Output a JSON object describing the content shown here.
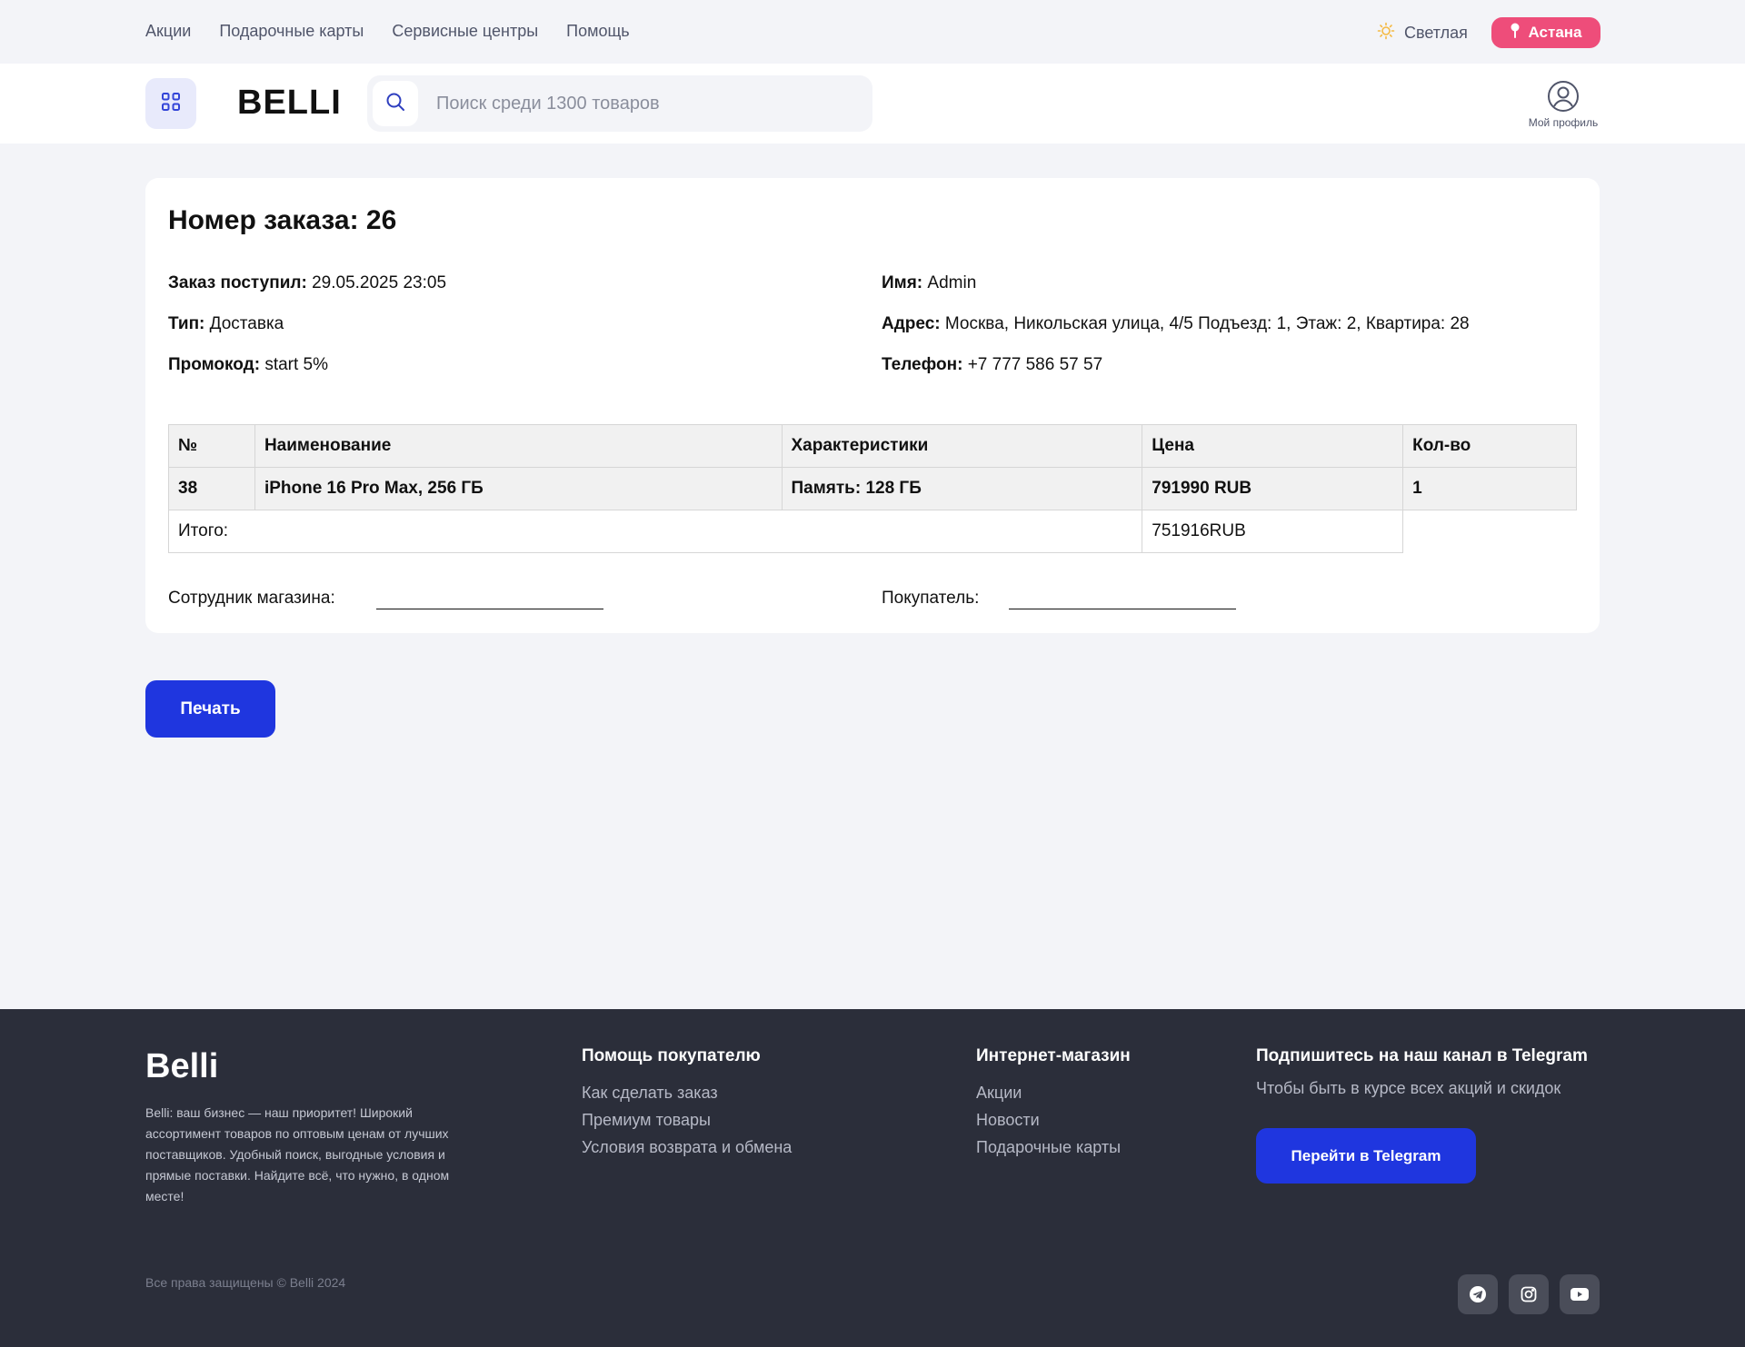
{
  "topnav": {
    "links": [
      "Акции",
      "Подарочные карты",
      "Сервисные центры",
      "Помощь"
    ],
    "theme_label": "Светлая",
    "city": "Астана"
  },
  "header": {
    "logo": "BELLI",
    "search_placeholder": "Поиск среди 1300 товаров",
    "profile_label": "Мой профиль"
  },
  "order": {
    "title": "Номер заказа: 26",
    "received_label": "Заказ поступил:",
    "received_value": "29.05.2025 23:05",
    "type_label": "Тип:",
    "type_value": "Доставка",
    "promo_label": "Промокод:",
    "promo_value": "start 5%",
    "name_label": "Имя:",
    "name_value": "Admin",
    "address_label": "Адрес:",
    "address_value": "Москва, Никольская улица, 4/5 Подъезд: 1, Этаж: 2, Квартира: 28",
    "phone_label": "Телефон:",
    "phone_value": "+7 777 586 57 57"
  },
  "table": {
    "headers": [
      "№",
      "Наименование",
      "Характеристики",
      "Цена",
      "Кол-во"
    ],
    "rows": [
      {
        "num": "38",
        "name": "iPhone 16 Pro Max, 256 ГБ",
        "specs": "Память: 128 ГБ",
        "price": "791990 RUB",
        "qty": "1"
      }
    ],
    "total_label": "Итого:",
    "total_value": "751916RUB"
  },
  "signatures": {
    "staff": "Сотрудник магазина:",
    "buyer": "Покупатель:"
  },
  "print_label": "Печать",
  "footer": {
    "logo": "Belli",
    "about": "Belli: ваш бизнес — наш приоритет! Широкий ассортимент товаров по оптовым ценам от лучших поставщиков. Удобный поиск, выгодные условия и прямые поставки. Найдите всё, что нужно, в одном месте!",
    "help_title": "Помощь покупателю",
    "help_links": [
      "Как сделать заказ",
      "Премиум товары",
      "Условия возврата и обмена"
    ],
    "shop_title": "Интернет-магазин",
    "shop_links": [
      "Акции",
      "Новости",
      "Подарочные карты"
    ],
    "tg_title": "Подпишитесь на наш канал в Telegram",
    "tg_subtitle": "Чтобы быть в курсе всех акций и скидок",
    "tg_button": "Перейти в Telegram",
    "copyright": "Все права защищены © Belli 2024",
    "social_icons": [
      "telegram-icon",
      "instagram-icon",
      "youtube-icon"
    ]
  },
  "colors": {
    "accent": "#1f36df",
    "city_badge": "#ee4d7a",
    "footer_bg": "#2b2e3a",
    "page_bg": "#f3f4f8"
  }
}
